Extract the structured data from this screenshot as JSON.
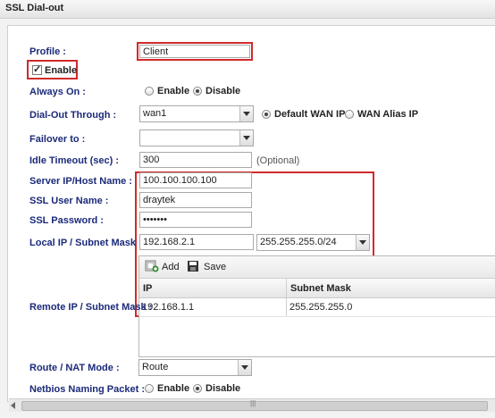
{
  "window": {
    "title": "SSL Dial-out"
  },
  "profile": {
    "label": "Profile :",
    "value": "Client"
  },
  "enable": {
    "label": "Enable",
    "checked": true
  },
  "always_on": {
    "label": "Always On :",
    "options": [
      "Enable",
      "Disable"
    ],
    "selected": "Disable"
  },
  "dial_out": {
    "label": "Dial-Out Through :",
    "value": "wan1",
    "options": [
      "Default WAN IP",
      "WAN Alias IP"
    ],
    "selected": "Default WAN IP"
  },
  "failover": {
    "label": "Failover to :",
    "value": ""
  },
  "idle_timeout": {
    "label": "Idle Timeout (sec) :",
    "value": "300",
    "hint": "(Optional)"
  },
  "server": {
    "label": "Server IP/Host Name :",
    "value": "100.100.100.100"
  },
  "ssl_user": {
    "label": "SSL User Name :",
    "value": "draytek"
  },
  "ssl_password": {
    "label": "SSL Password :",
    "value": "•••••••"
  },
  "local_ip": {
    "label": "Local IP / Subnet Mask :",
    "ip": "192.168.2.1",
    "mask": "255.255.255.0/24"
  },
  "remote": {
    "label": "Remote IP / Subnet Mask :",
    "add_label": "Add",
    "save_label": "Save",
    "columns": [
      "IP",
      "Subnet Mask"
    ],
    "rows": [
      {
        "ip": "192.168.1.1",
        "mask": "255.255.255.0"
      }
    ]
  },
  "route_nat": {
    "label": "Route / NAT Mode :",
    "value": "Route"
  },
  "netbios": {
    "label": "Netbios Naming Packet :",
    "options": [
      "Enable",
      "Disable"
    ],
    "selected": "Disable"
  },
  "colors": {
    "highlight": "#d12a2a",
    "label": "#1b2a7a"
  }
}
